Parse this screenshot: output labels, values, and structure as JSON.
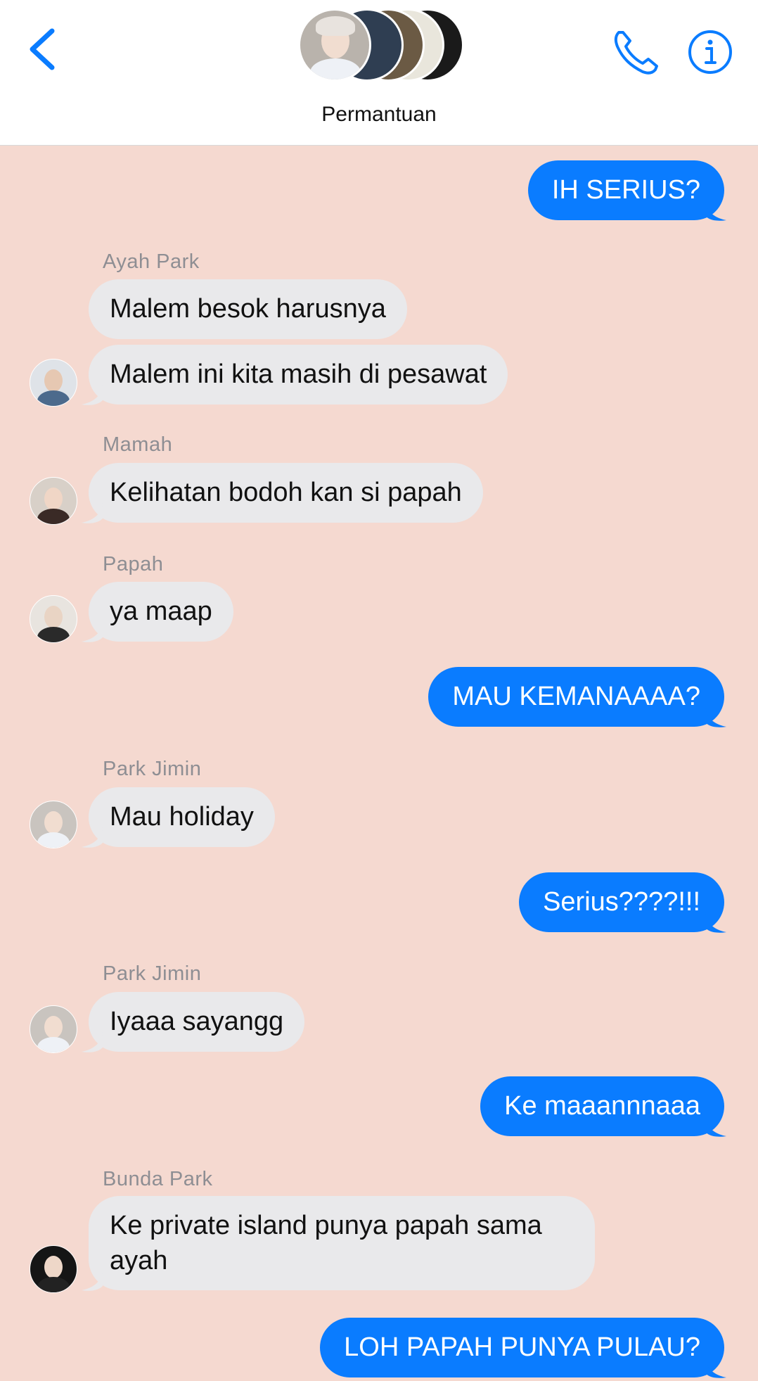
{
  "header": {
    "title": "Permantuan",
    "back_icon": "chevron-left-icon",
    "call_icon": "phone-icon",
    "info_icon": "info-icon",
    "accent_color": "#0a7cff"
  },
  "messages": [
    {
      "direction": "out",
      "text": "IH SERIUS?"
    },
    {
      "direction": "in",
      "sender": "Ayah Park",
      "texts": [
        "Malem besok harusnya",
        "Malem ini kita masih di pesawat"
      ]
    },
    {
      "direction": "in",
      "sender": "Mamah",
      "texts": [
        "Kelihatan bodoh kan si papah"
      ]
    },
    {
      "direction": "in",
      "sender": "Papah",
      "texts": [
        "ya maap"
      ]
    },
    {
      "direction": "out",
      "text": "MAU KEMANAAAA?"
    },
    {
      "direction": "in",
      "sender": "Park Jimin",
      "texts": [
        "Mau holiday"
      ]
    },
    {
      "direction": "out",
      "text": "Serius????!!!"
    },
    {
      "direction": "in",
      "sender": "Park Jimin",
      "texts": [
        "Iyaaa sayangg"
      ]
    },
    {
      "direction": "out",
      "text": "Ke maaannnaaa"
    },
    {
      "direction": "in",
      "sender": "Bunda Park",
      "texts": [
        "Ke private island punya papah sama ayah"
      ]
    },
    {
      "direction": "out",
      "text": "LOH PAPAH PUNYA PULAU?"
    }
  ],
  "colors": {
    "chat_background": "#f5d9d0",
    "incoming_bubble": "#e9e9eb",
    "outgoing_bubble": "#0a7cff",
    "sender_name": "#8e8e93"
  }
}
